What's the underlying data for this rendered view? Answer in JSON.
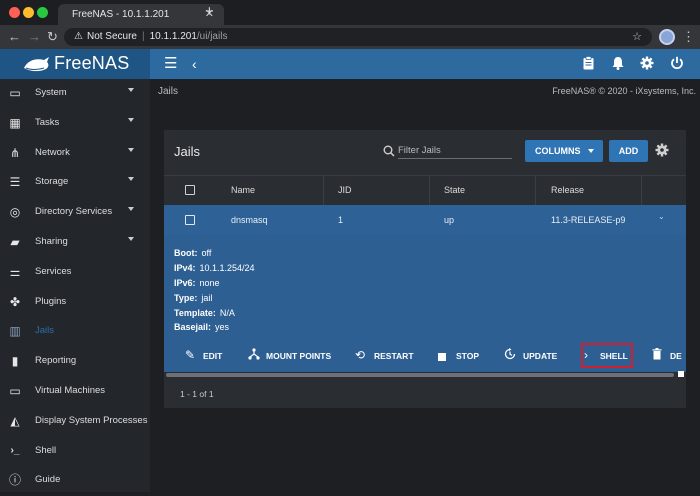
{
  "browser": {
    "tab_title": "FreeNAS - 10.1.1.201",
    "tab_close": "✕",
    "new_tab": "+",
    "security_label": "Not Secure",
    "url_host": "10.1.1.201",
    "url_path": "/ui/jails"
  },
  "app": {
    "logo_text": "FreeNAS",
    "breadcrumb": "Jails",
    "copyright": "FreeNAS® © 2020 - iXsystems, Inc."
  },
  "sidebar": {
    "items": [
      {
        "label": "System",
        "icon": "laptop-icon",
        "expandable": true
      },
      {
        "label": "Tasks",
        "icon": "calendar-icon",
        "expandable": true
      },
      {
        "label": "Network",
        "icon": "network-icon",
        "expandable": true
      },
      {
        "label": "Storage",
        "icon": "storage-icon",
        "expandable": true
      },
      {
        "label": "Directory Services",
        "icon": "directory-services-icon",
        "expandable": true
      },
      {
        "label": "Sharing",
        "icon": "folder-share-icon",
        "expandable": true
      },
      {
        "label": "Services",
        "icon": "sliders-icon",
        "expandable": false
      },
      {
        "label": "Plugins",
        "icon": "puzzle-icon",
        "expandable": false
      },
      {
        "label": "Jails",
        "icon": "jail-icon",
        "expandable": false,
        "active": true
      },
      {
        "label": "Reporting",
        "icon": "bar-chart-icon",
        "expandable": false
      },
      {
        "label": "Virtual Machines",
        "icon": "computer-icon",
        "expandable": false
      },
      {
        "label": "Display System Processes",
        "icon": "process-icon",
        "expandable": false
      },
      {
        "label": "Shell",
        "icon": "terminal-icon",
        "expandable": false
      },
      {
        "label": "Guide",
        "icon": "info-icon",
        "expandable": false
      }
    ]
  },
  "jails": {
    "title": "Jails",
    "search_placeholder": "Filter Jails",
    "columns_label": "COLUMNS",
    "add_label": "ADD",
    "headers": {
      "name": "Name",
      "jid": "JID",
      "state": "State",
      "release": "Release"
    },
    "row": {
      "name": "dnsmasq",
      "jid": "1",
      "state": "up",
      "release": "11.3-RELEASE-p9"
    },
    "details": {
      "boot_label": "Boot:",
      "boot": "off",
      "ipv4_label": "IPv4:",
      "ipv4": "10.1.1.254/24",
      "ipv6_label": "IPv6:",
      "ipv6": "none",
      "type_label": "Type:",
      "type": "jail",
      "template_label": "Template:",
      "template": "N/A",
      "basejail_label": "Basejail:",
      "basejail": "yes"
    },
    "actions": {
      "edit": "EDIT",
      "mount_points": "MOUNT POINTS",
      "restart": "RESTART",
      "stop": "STOP",
      "update": "UPDATE",
      "shell": "SHELL",
      "delete": "DE"
    },
    "pagination": "1 - 1 of 1"
  },
  "colors": {
    "topbar": "#2c6aa0",
    "sidebar": "#23272c",
    "row_selected": "#2e6297",
    "button": "#2f74b5",
    "highlight_box": "#d01f2f"
  }
}
